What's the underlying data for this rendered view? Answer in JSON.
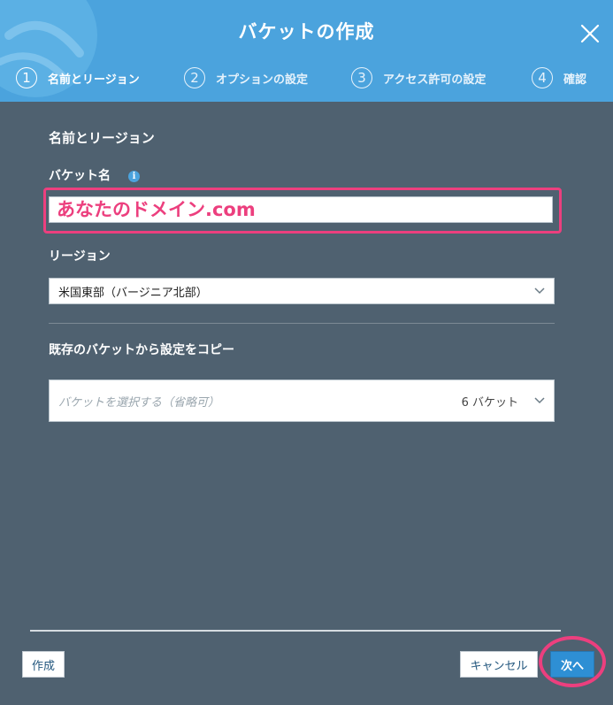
{
  "header": {
    "title": "バケットの作成",
    "close_icon": "close-icon"
  },
  "steps": [
    {
      "num": "1",
      "label": "名前とリージョン",
      "active": true
    },
    {
      "num": "2",
      "label": "オプションの設定",
      "active": false
    },
    {
      "num": "3",
      "label": "アクセス許可の設定",
      "active": false
    },
    {
      "num": "4",
      "label": "確認",
      "active": false
    }
  ],
  "form": {
    "section_title": "名前とリージョン",
    "bucket_name_label": "バケット名",
    "bucket_name_value": "あなたのドメイン.com",
    "info_icon": "i",
    "region_label": "リージョン",
    "region_value": "米国東部（バージニア北部）",
    "copy_label": "既存のバケットから設定をコピー",
    "copy_placeholder": "バケットを選択する（省略可）",
    "copy_count": "6 バケット"
  },
  "footer": {
    "create_label": "作成",
    "cancel_label": "キャンセル",
    "next_label": "次へ"
  },
  "colors": {
    "header_bg": "#4ba3dd",
    "body_bg": "#4f6170",
    "highlight": "#ec3f7e",
    "primary_button": "#2e8fd4"
  }
}
